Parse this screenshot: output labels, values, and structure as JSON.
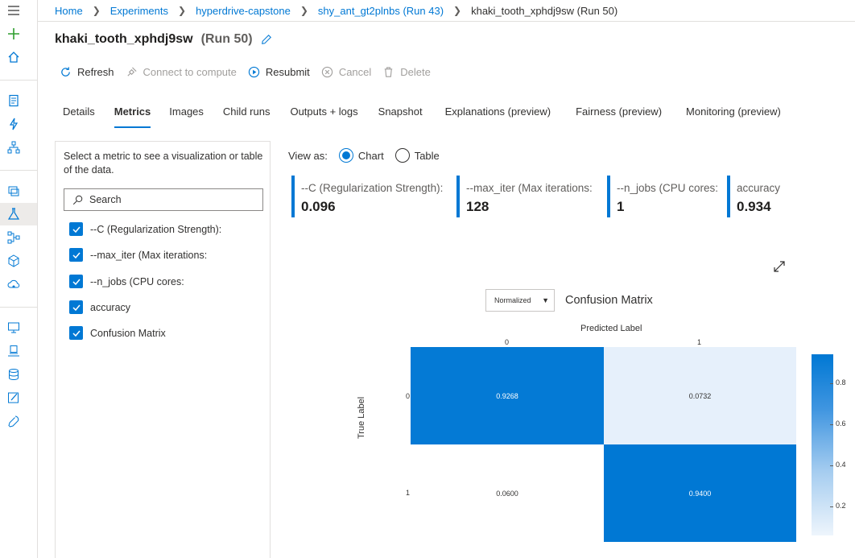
{
  "breadcrumb": [
    {
      "label": "Home"
    },
    {
      "label": "Experiments"
    },
    {
      "label": "hyperdrive-capstone"
    },
    {
      "label": "shy_ant_gt2plnbs (Run 43)"
    },
    {
      "label": "khaki_tooth_xphdj9sw (Run 50)"
    }
  ],
  "run": {
    "name": "khaki_tooth_xphdj9sw",
    "number": "(Run 50)"
  },
  "toolbar": {
    "refresh": "Refresh",
    "connect": "Connect to compute",
    "resubmit": "Resubmit",
    "cancel": "Cancel",
    "delete": "Delete"
  },
  "tabs": [
    "Details",
    "Metrics",
    "Images",
    "Child runs",
    "Outputs + logs",
    "Snapshot",
    "Explanations (preview)",
    "Fairness (preview)",
    "Monitoring (preview)"
  ],
  "selected_tab": "Metrics",
  "panel": {
    "hint": "Select a metric to see a visualization or table of the data.",
    "search_placeholder": "Search",
    "metrics": [
      "--C (Regularization Strength):",
      "--max_iter (Max iterations:",
      "--n_jobs (CPU cores:",
      "accuracy",
      "Confusion Matrix"
    ]
  },
  "view_as": {
    "label": "View as:",
    "chart": "Chart",
    "table": "Table",
    "selected": "Chart"
  },
  "cards": [
    {
      "label": "--C (Regularization Strength):",
      "value": "0.096"
    },
    {
      "label": "--max_iter (Max iterations:",
      "value": "128"
    },
    {
      "label": "--n_jobs (CPU cores:",
      "value": "1"
    },
    {
      "label": "accuracy",
      "value": "0.934"
    }
  ],
  "confusion": {
    "dropdown": "Normalized",
    "title": "Confusion Matrix",
    "predicted_label": "Predicted Label",
    "true_label": "True Label",
    "col_ticks": [
      "0",
      "1"
    ],
    "row_ticks": [
      "0",
      "1"
    ],
    "cells": [
      [
        "0.9268",
        "0.0732"
      ],
      [
        "0.0600",
        "0.9400"
      ]
    ],
    "colorbar_ticks": [
      "0.8",
      "0.6",
      "0.4",
      "0.2"
    ]
  },
  "colors": {
    "accent": "#0078d4"
  },
  "chart_data": {
    "type": "heatmap",
    "title": "Confusion Matrix",
    "xlabel": "Predicted Label",
    "ylabel": "True Label",
    "x": [
      "0",
      "1"
    ],
    "y": [
      "0",
      "1"
    ],
    "values": [
      [
        0.9268,
        0.0732
      ],
      [
        0.06,
        0.94
      ]
    ],
    "colorbar_range": [
      0,
      1
    ]
  }
}
